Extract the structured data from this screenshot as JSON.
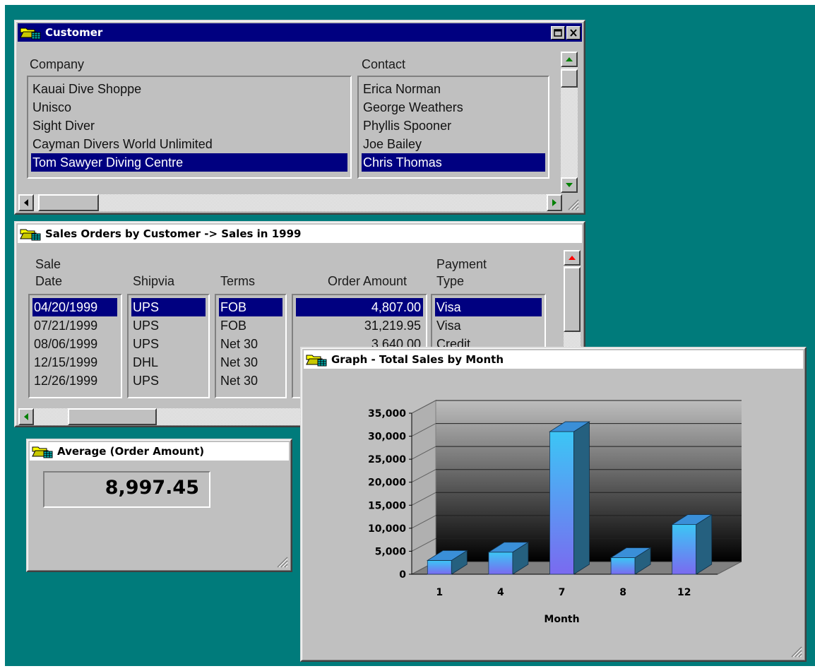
{
  "customer_window": {
    "title": "Customer",
    "company_header": "Company",
    "contact_header": "Contact",
    "companies": [
      "Kauai Dive Shoppe",
      "Unisco",
      "Sight Diver",
      "Cayman Divers World Unlimited",
      "Tom Sawyer Diving Centre"
    ],
    "contacts": [
      "Erica Norman",
      "George Weathers",
      "Phyllis Spooner",
      "Joe Bailey",
      "Chris Thomas"
    ],
    "selected_index": 4
  },
  "sales_window": {
    "title": "Sales Orders by Customer -> Sales in 1999",
    "headers": {
      "sale_date_1": "Sale",
      "sale_date_2": "Date",
      "shipvia": "Shipvia",
      "terms": "Terms",
      "order_amount": "Order Amount",
      "payment_type_1": "Payment",
      "payment_type_2": "Type"
    },
    "sale_dates": [
      "04/20/1999",
      "07/21/1999",
      "08/06/1999",
      "12/15/1999",
      "12/26/1999"
    ],
    "shipvia": [
      "UPS",
      "UPS",
      "UPS",
      "DHL",
      "UPS"
    ],
    "terms": [
      "FOB",
      "FOB",
      "Net 30",
      "Net 30",
      "Net 30"
    ],
    "order_amounts": [
      "4,807.00",
      "31,219.95",
      "3,640.00"
    ],
    "payment_types": [
      "Visa",
      "Visa",
      "Credit"
    ],
    "selected_index": 0
  },
  "average_window": {
    "title": "Average (Order Amount)",
    "value": "8,997.45"
  },
  "graph_window": {
    "title": "Graph - Total Sales by Month"
  },
  "chart_data": {
    "type": "bar",
    "title": "",
    "xlabel": "Month",
    "ylabel": "",
    "categories": [
      "1",
      "4",
      "7",
      "8",
      "12"
    ],
    "values": [
      3000,
      4800,
      31000,
      3600,
      10800
    ],
    "ylim": [
      0,
      35000
    ],
    "yticks": [
      "35,000",
      "30,000",
      "25,000",
      "20,000",
      "15,000",
      "10,000",
      "5,000",
      "0"
    ],
    "grid": true,
    "style": "3d",
    "colors": {
      "bar_front": "#3cc6f5",
      "bar_front_bottom": "#7a6af0",
      "bar_top": "#3a8fd8",
      "bar_side": "#25607f"
    }
  },
  "colors": {
    "desktop": "#007b7b",
    "selection": "#000080",
    "window_face": "#c0c0c0"
  },
  "icons": {
    "title_icon": "folder-grid-icon",
    "close": "close-icon",
    "maximize": "maximize-icon",
    "scroll_up": "arrow-up-icon",
    "scroll_down": "arrow-down-icon",
    "scroll_left": "arrow-left-icon",
    "scroll_right": "arrow-right-icon",
    "resize": "size-grip-icon"
  }
}
